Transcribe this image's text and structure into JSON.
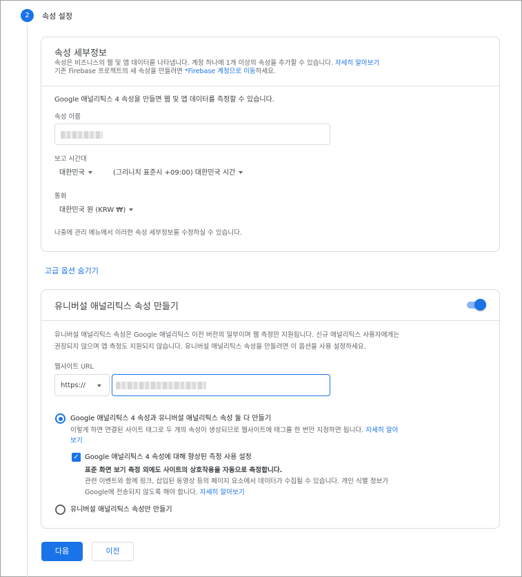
{
  "step": {
    "number": "2",
    "title": "속성 설정"
  },
  "details_card": {
    "title": "속성 세부정보",
    "desc_line1": "속성은 비즈니스의 웹 및 앱 데이터를 나타냅니다. 계정 하나에 1개 이상의 속성을 추가할 수 있습니다.",
    "desc_link1": "자세히 알아보기",
    "desc_line2_pre": "기존 Firebase 프로젝트의 새 속성을 만들려면 ",
    "desc_link2": "*Firebase 계정으로 이동",
    "desc_line2_post": "하세요.",
    "intro": "Google 애널리틱스 4 속성을 만들면 웹 및 앱 데이터를 측정할 수 있습니다.",
    "property_name_label": "속성 이름",
    "timezone_label": "보고 시간대",
    "timezone_country": "대한민국",
    "timezone_value": "(그리니치 표준시 +09:00) 대한민국 시간",
    "currency_label": "통화",
    "currency_value": "대한민국 원 (KRW ₩)",
    "footnote": "나중에 관리 메뉴에서 이러한 속성 세부정보를 수정하실 수 있습니다."
  },
  "advanced_toggle_link": "고급 옵션 숨기기",
  "ua_card": {
    "title": "유니버설 애널리틱스 속성 만들기",
    "toggle_on": true,
    "desc_line1": "유니버설 애널리틱스 속성은 Google 애널리틱스 이전 버전의 일부이며 웹 측정만 지원됩니다. 신규 애널리틱스 사용자에게는",
    "desc_line2": "권장되지 않으며 앱 측정도 지원되지 않습니다. 유니버설 애널리틱스 속성을 만들려면 이 옵션을 사용 설정하세요.",
    "url_label": "웹사이트 URL",
    "protocol": "https://",
    "option_both_label": "Google 애널리틱스 4 속성과 유니버설 애널리틱스 속성 둘 다 만들기",
    "option_both_desc": "이렇게 하면 연결된 사이트 태그로 두 개의 속성이 생성되므로 웹사이트에 태그를 한 번만 지정하면 됩니다.",
    "option_both_link_a": "자세히 알아",
    "option_both_link_b": "보기",
    "enhanced_label": "Google 애널리틱스 4 속성에 대해 향상된 측정 사용 설정",
    "enhanced_bold": "표준 화면 보기 측정 외에도 사이트의 상호작용을 자동으로 측정합니다.",
    "enhanced_desc1": "관련 이벤트와 함께 링크, 삽입된 동영상 등의 페이지 요소에서 데이터가 수집될 수 있습니다. 개인 식별 정보가",
    "enhanced_desc2": "Google에 전송되지 않도록 해야 합니다. ",
    "enhanced_link": "자세히 알아보기",
    "option_ua_only_label": "유니버설 애널리틱스 속성만 만들기",
    "selected_option": "both",
    "enhanced_checked": true
  },
  "buttons": {
    "next": "다음",
    "prev": "이전"
  },
  "colors": {
    "accent": "#1a73e8",
    "border": "#dadce0"
  }
}
